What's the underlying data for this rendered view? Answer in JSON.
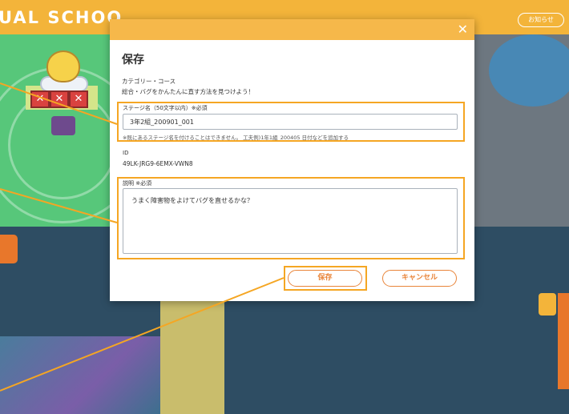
{
  "app": {
    "brand": "UAL SCHOO",
    "notice_label": "お知らせ",
    "accent": "#f3b43a"
  },
  "modal": {
    "title": "保存",
    "close_icon": "close-icon",
    "category_label": "カテゴリー・コース",
    "category_value": "総合・バグをかんたんに直す方法を見つけよう！",
    "stage_name_label": "ステージ名（50文字以内）※必須",
    "stage_name_value": "3年2組_200901_001",
    "stage_name_note": "※既にあるステージ名を付けることはできません。 工夫例)1年1組_200405 日付などを追加する",
    "id_label": "ID",
    "id_value": "49LK-JRG9-6EMX-VWN8",
    "description_label": "説明 ※必須",
    "description_value": "うまく障害物をよけてバグを直せるかな？",
    "save_label": "保存",
    "cancel_label": "キャンセル",
    "button_color": "#e9853a"
  },
  "annotation": {
    "highlight_color": "#f5a623"
  }
}
